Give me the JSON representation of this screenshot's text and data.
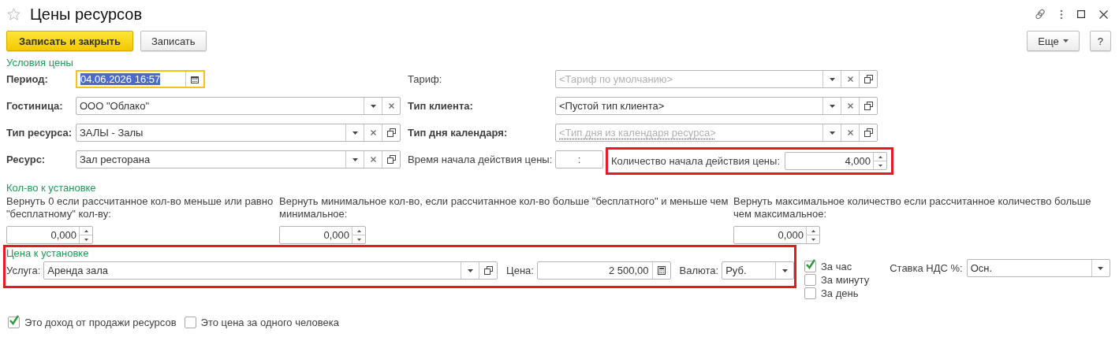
{
  "window": {
    "title": "Цены ресурсов"
  },
  "toolbar": {
    "buttons": [
      {
        "label": "Записать и закрыть",
        "kind": "primary"
      },
      {
        "label": "Записать",
        "kind": "default"
      }
    ],
    "more": "Еще",
    "help": "?"
  },
  "price_conditions": {
    "title": "Условия цены",
    "left": [
      {
        "label": "Период:",
        "bold": true,
        "value": "04.06.2026 16:57",
        "selected": true,
        "focused": true,
        "buttons": [
          {
            "kind": "calendar"
          }
        ]
      },
      {
        "label": "Гостиница:",
        "bold": true,
        "value": "ООО \"Облако\"",
        "selected": false,
        "focused": false,
        "buttons": [
          {
            "kind": "dropdown"
          },
          {
            "kind": "clear"
          }
        ]
      },
      {
        "label": "Тип ресурса:",
        "bold": true,
        "value": "ЗАЛЫ - Залы",
        "selected": false,
        "focused": false,
        "buttons": [
          {
            "kind": "dropdown"
          },
          {
            "kind": "clear"
          },
          {
            "kind": "open"
          }
        ]
      },
      {
        "label": "Ресурс:",
        "bold": true,
        "value": "Зал ресторана",
        "selected": false,
        "focused": false,
        "buttons": [
          {
            "kind": "dropdown"
          },
          {
            "kind": "clear"
          },
          {
            "kind": "open"
          }
        ]
      }
    ],
    "right": [
      {
        "label": "Тариф:",
        "bold": false,
        "placeholder": "<Тариф по умолчанию>",
        "required": false,
        "buttons": [
          {
            "kind": "dropdown"
          },
          {
            "kind": "clear"
          },
          {
            "kind": "open"
          }
        ]
      },
      {
        "label": "Тип клиента:",
        "bold": true,
        "value": "<Пустой тип клиента>",
        "required": false,
        "buttons": [
          {
            "kind": "dropdown"
          },
          {
            "kind": "clear"
          },
          {
            "kind": "open"
          }
        ]
      },
      {
        "label": "Тип дня календаря:",
        "bold": true,
        "placeholder": "<Тип дня из календаря ресурса>",
        "required": true,
        "buttons": [
          {
            "kind": "dropdown"
          },
          {
            "kind": "clear"
          },
          {
            "kind": "open"
          }
        ]
      }
    ],
    "time": {
      "label": "Время начала действия цены:",
      "value": ":"
    },
    "start_qty": {
      "label": "Количество начала действия цены:",
      "value": "4,000",
      "highlighted": true
    }
  },
  "quantity": {
    "title": "Кол-во к установке",
    "items": [
      {
        "label": "Вернуть 0 если рассчитанное кол-во меньше или равно \"бесплатному\" кол-ву:",
        "value": "0,000"
      },
      {
        "label": "Вернуть минимальное кол-во, если рассчитанное кол-во больше \"бесплатного\" и меньше чем минимальное:",
        "value": "0,000"
      },
      {
        "label": "Вернуть максимальное количество если рассчитанное количество больше чем максимальное:",
        "value": "0,000"
      }
    ]
  },
  "price": {
    "title": "Цена к установке",
    "highlighted": true,
    "service": {
      "label": "Услуга:",
      "value": "Аренда зала",
      "buttons": [
        {
          "kind": "dropdown"
        },
        {
          "kind": "open"
        }
      ]
    },
    "amount": {
      "label": "Цена:",
      "value": "2 500,00",
      "buttons": [
        {
          "kind": "calculator"
        }
      ]
    },
    "currency": {
      "label": "Валюта:",
      "value": "Руб.",
      "buttons": [
        {
          "kind": "dropdown"
        }
      ]
    },
    "periods": [
      {
        "label": "За час",
        "checked": true
      },
      {
        "label": "За минуту",
        "checked": false
      },
      {
        "label": "За день",
        "checked": false
      }
    ],
    "vat": {
      "label": "Ставка НДС %:",
      "value": "Осн.",
      "buttons": [
        {
          "kind": "dropdown"
        }
      ]
    }
  },
  "flags": [
    {
      "label": "Это доход от продажи ресурсов",
      "checked": true
    },
    {
      "label": "Это цена за одного человека",
      "checked": false
    }
  ]
}
